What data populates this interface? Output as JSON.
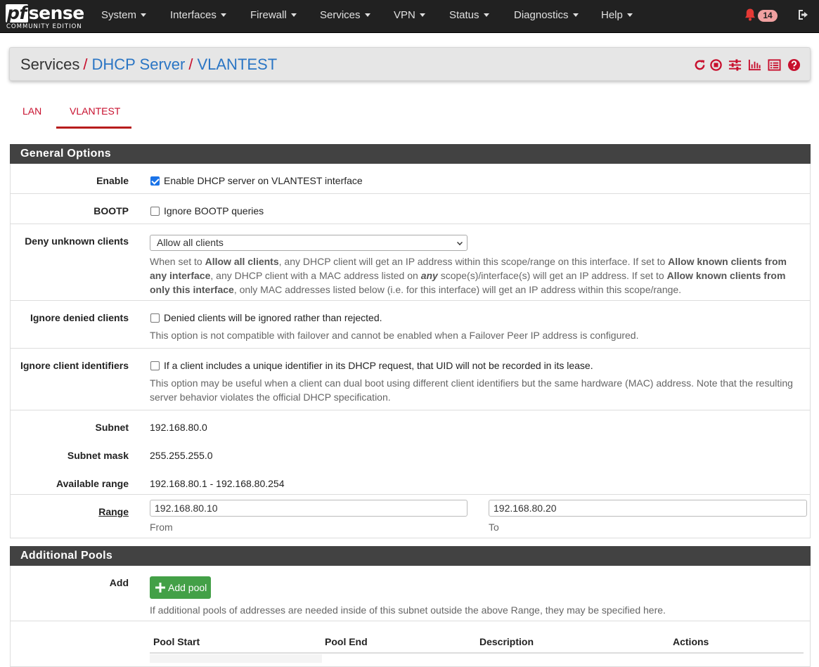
{
  "brand": {
    "logo_pf": "pf",
    "logo_rest": "sense",
    "edition": "COMMUNITY EDITION"
  },
  "nav": {
    "items": [
      "System",
      "Interfaces",
      "Firewall",
      "Services",
      "VPN",
      "Status",
      "Diagnostics",
      "Help"
    ],
    "notification_count": "14"
  },
  "breadcrumb": {
    "part1": "Services",
    "part2": "DHCP Server",
    "part3": "VLANTEST",
    "separator": "/"
  },
  "header_icons": [
    "restart-icon",
    "stop-icon",
    "settings-sliders-icon",
    "chart-icon",
    "log-list-icon",
    "help-icon"
  ],
  "tabs": [
    {
      "label": "LAN",
      "active": false
    },
    {
      "label": "VLANTEST",
      "active": true
    }
  ],
  "general": {
    "title": "General Options",
    "enable": {
      "label": "Enable",
      "checkbox": "Enable DHCP server on VLANTEST interface",
      "checked": true
    },
    "bootp": {
      "label": "BOOTP",
      "checkbox": "Ignore BOOTP queries",
      "checked": false
    },
    "deny": {
      "label": "Deny unknown clients",
      "selected": "Allow all clients",
      "help_1": "When set to ",
      "help_b1": "Allow all clients",
      "help_2": ", any DHCP client will get an IP address within this scope/range on this interface. If set to ",
      "help_b2": "Allow known clients from any interface",
      "help_3": ", any DHCP client with a MAC address listed on ",
      "help_em": "any",
      "help_4": " scope(s)/interface(s) will get an IP address. If set to ",
      "help_b3": "Allow known clients from only this interface",
      "help_5": ", only MAC addresses listed below (i.e. for this interface) will get an IP address within this scope/range."
    },
    "ignore_denied": {
      "label": "Ignore denied clients",
      "checkbox": "Denied clients will be ignored rather than rejected.",
      "checked": false,
      "help": "This option is not compatible with failover and cannot be enabled when a Failover Peer IP address is configured."
    },
    "ignore_ids": {
      "label": "Ignore client identifiers",
      "checkbox": "If a client includes a unique identifier in its DHCP request, that UID will not be recorded in its lease.",
      "checked": false,
      "help": "This option may be useful when a client can dual boot using different client identifiers but the same hardware (MAC) address. Note that the resulting server behavior violates the official DHCP specification."
    },
    "subnet": {
      "label": "Subnet",
      "value": "192.168.80.0"
    },
    "mask": {
      "label": "Subnet mask",
      "value": "255.255.255.0"
    },
    "available": {
      "label": "Available range",
      "value": "192.168.80.1 - 192.168.80.254"
    },
    "range": {
      "label": "Range",
      "from": "192.168.80.10",
      "to": "192.168.80.20",
      "from_label": "From",
      "to_label": "To"
    }
  },
  "pools": {
    "title": "Additional Pools",
    "add_label": "Add",
    "add_button": "Add pool",
    "help": "If additional pools of addresses are needed inside of this subnet outside the above Range, they may be specified here.",
    "columns": [
      "Pool Start",
      "Pool End",
      "Description",
      "Actions"
    ]
  },
  "colors": {
    "navbar": "#212121",
    "accent": "#c8102e",
    "link": "#2a75c4",
    "panel_heading": "#424242",
    "success": "#43a047"
  }
}
